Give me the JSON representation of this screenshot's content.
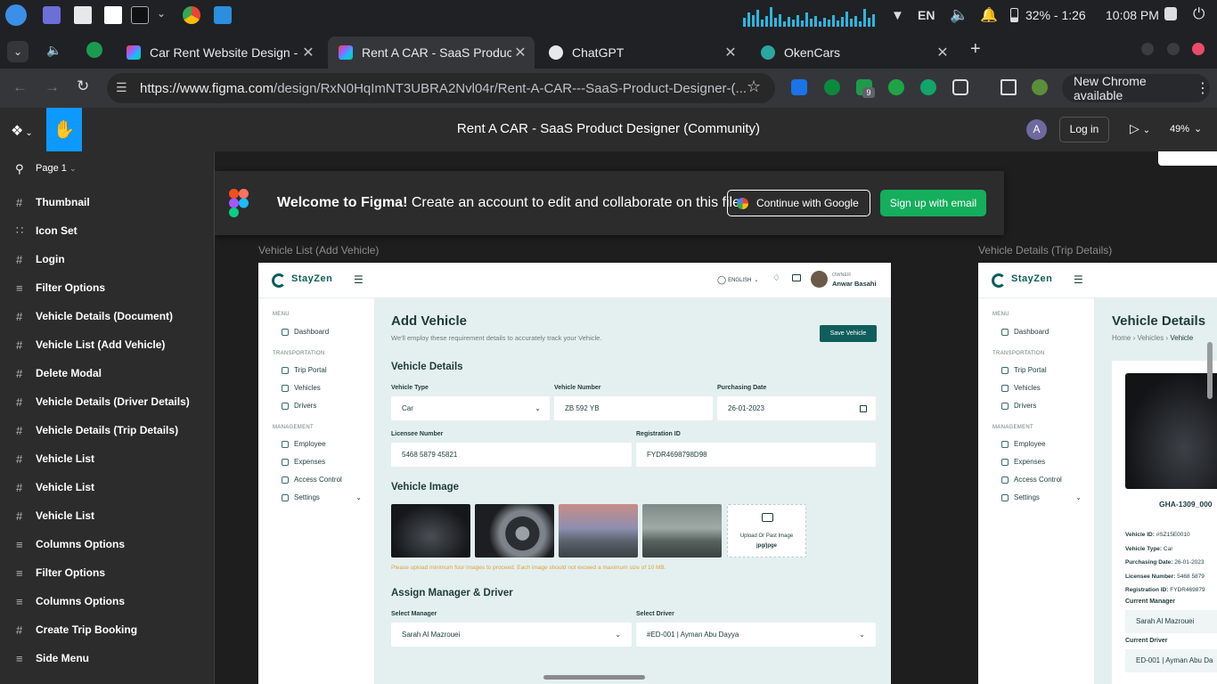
{
  "taskbar": {
    "language": "EN",
    "battery": "32% - 1:26",
    "clock": "10:08 PM"
  },
  "tabs": [
    {
      "title": "Car Rent Website Design - P",
      "active": false
    },
    {
      "title": "Rent A CAR - SaaS Product D",
      "active": true
    },
    {
      "title": "ChatGPT",
      "active": false
    },
    {
      "title": "OkenCars",
      "active": false
    }
  ],
  "toolbar": {
    "url_host": "https://www.figma.com",
    "url_path": "/design/RxN0HqImNT3UBRA2Nvl04r/Rent-A-CAR---SaaS-Product-Designer-(...",
    "ext_badge": "9",
    "update_label": "New Chrome available"
  },
  "figma": {
    "file_title": "Rent A CAR - SaaS Product Designer (Community)",
    "avatar_letter": "A",
    "login_label": "Log in",
    "zoom": "49%",
    "page_name": "Page 1"
  },
  "layers": [
    {
      "icon": "frame",
      "label": "Thumbnail"
    },
    {
      "icon": "grid",
      "label": "Icon Set"
    },
    {
      "icon": "frame",
      "label": "Login"
    },
    {
      "icon": "list",
      "label": "Filter Options"
    },
    {
      "icon": "frame",
      "label": "Vehicle Details (Document)"
    },
    {
      "icon": "frame",
      "label": "Vehicle List (Add Vehicle)"
    },
    {
      "icon": "frame",
      "label": "Delete Modal"
    },
    {
      "icon": "frame",
      "label": "Vehicle Details (Driver Details)"
    },
    {
      "icon": "frame",
      "label": "Vehicle Details (Trip Details)"
    },
    {
      "icon": "frame",
      "label": "Vehicle List"
    },
    {
      "icon": "frame",
      "label": "Vehicle List"
    },
    {
      "icon": "frame",
      "label": "Vehicle List"
    },
    {
      "icon": "list",
      "label": "Columns Options"
    },
    {
      "icon": "list",
      "label": "Filter Options"
    },
    {
      "icon": "list",
      "label": "Columns Options"
    },
    {
      "icon": "frame",
      "label": "Create Trip Booking"
    },
    {
      "icon": "list",
      "label": "Side Menu"
    }
  ],
  "banner": {
    "title": "Welcome to Figma!",
    "text": "Create an account to edit and collaborate on this file.",
    "google_label": "Continue with Google",
    "email_label": "Sign up with email"
  },
  "frame1": {
    "label": "Vehicle List (Add Vehicle)",
    "brand": "StayZen",
    "lang": "ENGLISH",
    "owner_role": "OWNER",
    "owner_name": "Anwar Basahi",
    "menu": {
      "menu_h": "MENU",
      "dashboard": "Dashboard",
      "transport_h": "TRANSPORTATION",
      "trip_portal": "Trip Portal",
      "vehicles": "Vehicles",
      "drivers": "Drivers",
      "management_h": "MANAGEMENT",
      "employee": "Employee",
      "expenses": "Expenses",
      "access": "Access Control",
      "settings": "Settings"
    },
    "title": "Add Vehicle",
    "subtitle": "We'll employ these requirement details to accurately track your Vehicle.",
    "save_label": "Save Vehicle",
    "details_h": "Vehicle Details",
    "type_l": "Vehicle Type",
    "type_v": "Car",
    "number_l": "Vehicle Number",
    "number_v": "ZB 592 YB",
    "date_l": "Purchasing Date",
    "date_v": "26-01-2023",
    "licensee_l": "Licensee Number",
    "licensee_v": "5468 5879 45821",
    "reg_l": "Registration ID",
    "reg_v": "FYDR4698798D98",
    "image_h": "Vehicle Image",
    "upload_l": "Upload Or Past Image",
    "upload_fmt": "jpg/jpge",
    "warning": "Please upload minimum four images to proceed. Each image should not exceed a maximum size of 10 MB.",
    "assign_h": "Assign Manager & Driver",
    "manager_l": "Select Manager",
    "manager_v": "Sarah Al Mazrouei",
    "driver_l": "Select Driver",
    "driver_v": "#ED-001 | Ayman Abu Dayya"
  },
  "frame2": {
    "label": "Vehicle Details (Trip Details)",
    "title": "Vehicle Details",
    "crumb_home": "Home",
    "crumb_vehicles": "Vehicles",
    "crumb_vehicle": "Vehicle",
    "car_code": "GHA-1309_000",
    "vid_l": "Vehicle ID:",
    "vid_v": "#SZ15E0010",
    "vtype_l": "Vehicle Type:",
    "vtype_v": "Car",
    "pdate_l": "Purchasing Date:",
    "pdate_v": "26-01-2023",
    "lic_l": "Licensee Number:",
    "lic_v": "5468 5879",
    "reg_l": "Registration ID:",
    "reg_v": "FYDR469879",
    "mgr_l": "Current Manager",
    "mgr_v": "Sarah Al Mazrouei",
    "drv_l": "Current Driver",
    "drv_v": "ED-001 | Ayman Abu Da"
  },
  "colors": {
    "figma_green": "#14ae5c",
    "brand_teal": "#0f5e5c",
    "hand_active": "#0d99ff"
  }
}
